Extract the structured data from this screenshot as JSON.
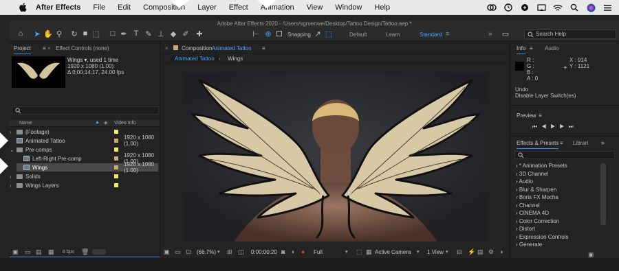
{
  "menubar": {
    "app_name": "After Effects",
    "items": [
      "File",
      "Edit",
      "Composition",
      "Layer",
      "Effect",
      "Animation",
      "View",
      "Window",
      "Help"
    ]
  },
  "window_title": "Adobe After Effects 2020 - /Users/sgruenwe/Desktop/Tattoo Design/Tattoo.aep *",
  "toolbar": {
    "snapping_label": "Snapping",
    "workspaces": [
      "Default",
      "Learn",
      "Standard"
    ],
    "active_workspace": "Standard",
    "search_placeholder": "Search Help"
  },
  "project_panel": {
    "tab_project": "Project",
    "tab_effect_controls": "Effect Controls (none)",
    "thumb_name": "Wings ▾, used 1 time",
    "thumb_size": "1920 x 1080 (1.00)",
    "thumb_duration": "Δ 0;00;14;17, 24.00 fps",
    "col_name": "Name",
    "col_video_info": "Video Info",
    "rows": [
      {
        "name": "(Footage)",
        "info": "",
        "color": "#f3e85a"
      },
      {
        "name": "Animated Tattoo",
        "info": "1920 x 1080 (1.00)",
        "color": "#c9a97a"
      },
      {
        "name": "Pre-comps",
        "info": "",
        "color": "#f3e85a"
      },
      {
        "name": "Left-Right Pre-comp",
        "info": "1920 x 1080 (1.00)",
        "color": "#c9a97a"
      },
      {
        "name": "Wings",
        "info": "1920 x 1080 (1.00)",
        "color": "#c9a97a"
      },
      {
        "name": "Solids",
        "info": "",
        "color": "#f3e85a"
      },
      {
        "name": "Wings Layers",
        "info": "",
        "color": "#f3e85a"
      }
    ],
    "bpc": "8 bpc"
  },
  "comp_panel": {
    "prefix": "Composition",
    "comp_name": "Animated Tattoo",
    "breadcrumb_active": "Animated Tattoo",
    "breadcrumb_next": "Wings",
    "zoom": "(66.7%)",
    "timecode": "0:00:00:20",
    "resolution": "Full",
    "camera": "Active Camera",
    "views": "1 View"
  },
  "info_panel": {
    "tab_info": "Info",
    "tab_audio": "Audio",
    "r": "R :",
    "g": "G :",
    "b": "B :",
    "a": "A :  0",
    "x": "X : 914",
    "y": "Y : 1121",
    "undo": "Undo",
    "undo_action": "Disable Layer Switch(es)"
  },
  "preview_panel": {
    "title": "Preview"
  },
  "effects_panel": {
    "title": "Effects & Presets",
    "tab_libraries": "Librari",
    "items": [
      "* Animation Presets",
      "3D Channel",
      "Audio",
      "Blur & Sharpen",
      "Boris FX Mocha",
      "Channel",
      "CINEMA 4D",
      "Color Correction",
      "Distort",
      "Expression Controls",
      "Generate"
    ]
  },
  "colors": {
    "accent": "#2d8ceb",
    "canvas": "#2a2a2e",
    "wing_fill": "#d7c8a6"
  }
}
